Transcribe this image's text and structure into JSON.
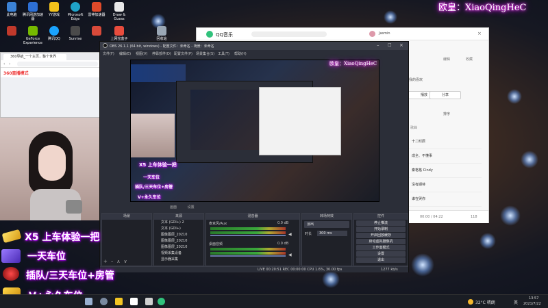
{
  "overlay": {
    "watermark": "欧皇：XiaoQingHeC",
    "rules": [
      "X5 上车体验一把",
      "一天车位",
      "插队/三天车位+房管",
      "V+永久车位"
    ]
  },
  "desktop_icons": [
    {
      "label": "此电脑",
      "color": "#3b82d6"
    },
    {
      "label": "腾讯网游加速器",
      "color": "#2d6fd4"
    },
    {
      "label": "YY游戏",
      "color": "#f2c21b"
    },
    {
      "label": "Microsoft Edge",
      "color": "#1fa3c9"
    },
    {
      "label": "雷神加速器",
      "color": "#e04a2a"
    },
    {
      "label": "Draw & Guess",
      "color": "#e8e8e8"
    },
    {
      "label": "",
      "color": "#c0392b"
    },
    {
      "label": "GeForce Experience",
      "color": "#76b900"
    },
    {
      "label": "腾讯QQ",
      "color": "#1aa3ff"
    },
    {
      "label": "Sunrise",
      "color": "#4a4a4a"
    },
    {
      "label": "",
      "color": "#d84a3a"
    },
    {
      "label": "上网宝盒子",
      "color": "#e84c3d"
    },
    {
      "label": "回收站",
      "color": "#9aa7b5"
    }
  ],
  "qq_music": {
    "app_name": "QQ音乐",
    "user": "Jasmin",
    "buttons": [
      "播放",
      "分享"
    ],
    "sort": "排序",
    "small_icons": [
      "编辑",
      "收藏"
    ],
    "meta": "我的喜欢",
    "list_header": "歌曲",
    "songs": [
      "十二时辰",
      "成全、不懂事",
      "秦格格 Cindy",
      "没有期待",
      "谁在哭你"
    ],
    "time": "00:00 / 04:22",
    "count": "118"
  },
  "browser": {
    "tab_title": "360导航_一个主页，整个世界",
    "site": "360直播模式"
  },
  "obs": {
    "title": "OBS 26.1.1 (64 bit, windows) - 配置文件：未命名 - 场景：未命名",
    "menu": [
      "文件(F)",
      "编辑(E)",
      "视图(V)",
      "停靠部件(D)",
      "配置文件(P)",
      "场景集合(S)",
      "工具(T)",
      "帮助(H)"
    ],
    "studio_labels": [
      "画面",
      "设置"
    ],
    "scenes_header": "场景",
    "sources_header": "来源",
    "sources": [
      "文本 (GDI+) 2",
      "文本 (GDI+)",
      "图像图层_20210",
      "图像图层_20210",
      "图像图层_20210",
      "视频采集设备",
      "显示器采集"
    ],
    "mixer_header": "混音器",
    "mixer": [
      {
        "label": "麦克风/Aux",
        "db": "0.0 dB"
      },
      {
        "label": "桌面音频",
        "db": "0.0 dB"
      }
    ],
    "transitions_header": "转场特效",
    "transition": "淡出",
    "duration_label": "时长",
    "duration": "300 ms",
    "controls_header": "控件",
    "controls": [
      "停止推流",
      "开始录制",
      "开启回放缓存",
      "启动虚拟摄像机",
      "工作室模式",
      "设置",
      "退出"
    ],
    "status": "LIVE 00:20:51   REC 00:00:00   CPU 1.6%, 30.00 fps",
    "kb": "1277 kb/s"
  },
  "taskbar": {
    "temperature": "32°C 晴朗",
    "language": "英",
    "time": "13:57",
    "date": "2021/7/22"
  }
}
